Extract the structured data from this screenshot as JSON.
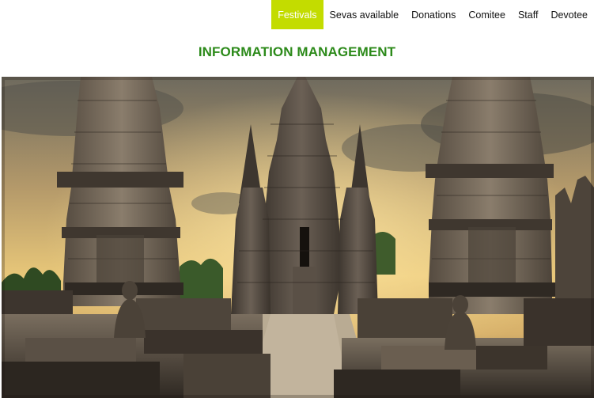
{
  "nav": {
    "items": [
      {
        "label": "Festivals",
        "active": true
      },
      {
        "label": "Sevas available",
        "active": false
      },
      {
        "label": "Donations",
        "active": false
      },
      {
        "label": "Comitee",
        "active": false
      },
      {
        "label": "Staff",
        "active": false
      },
      {
        "label": "Devotee",
        "active": false
      }
    ],
    "active_color": "#c3dc00"
  },
  "header": {
    "title": "INFORMATION MANAGEMENT",
    "title_color": "#2c8a1a"
  }
}
